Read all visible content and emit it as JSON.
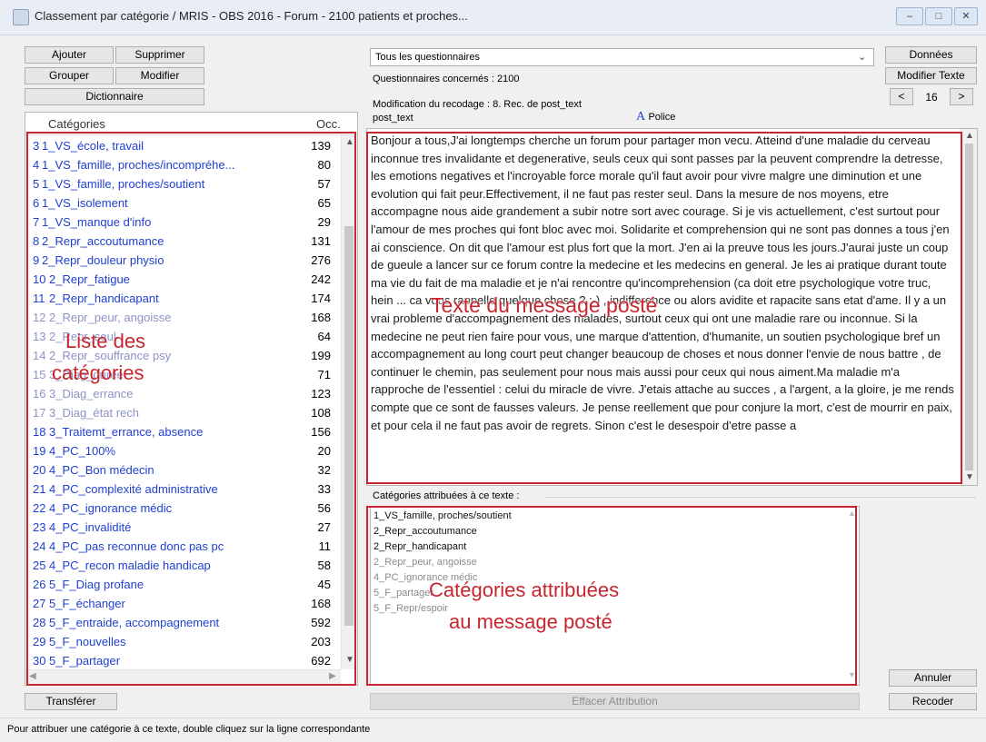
{
  "window": {
    "title": "Classement par catégorie / MRIS - OBS 2016 - Forum - 2100 patients et proches...",
    "minimize": "–",
    "maximize": "□",
    "close": "✕"
  },
  "left_buttons": {
    "add": "Ajouter",
    "delete": "Supprimer",
    "group": "Grouper",
    "modify": "Modifier",
    "dictionary": "Dictionnaire"
  },
  "categories": {
    "header_label": "Catégories",
    "header_count": "Occ.",
    "items": [
      {
        "num": "3",
        "label": "1_VS_école, travail",
        "occ": "139",
        "color": "#1f3fd1"
      },
      {
        "num": "4",
        "label": "1_VS_famille, proches/incompréhe...",
        "occ": "80",
        "color": "#1f3fd1"
      },
      {
        "num": "5",
        "label": "1_VS_famille, proches/soutient",
        "occ": "57",
        "color": "#1f3fd1"
      },
      {
        "num": "6",
        "label": "1_VS_isolement",
        "occ": "65",
        "color": "#1f3fd1"
      },
      {
        "num": "7",
        "label": "1_VS_manque d'info",
        "occ": "29",
        "color": "#1f3fd1"
      },
      {
        "num": "8",
        "label": "2_Repr_accoutumance",
        "occ": "131",
        "color": "#1f3fd1"
      },
      {
        "num": "9",
        "label": "2_Repr_douleur physio",
        "occ": "276",
        "color": "#1f3fd1"
      },
      {
        "num": "10",
        "label": "2_Repr_fatigue",
        "occ": "242",
        "color": "#1f3fd1"
      },
      {
        "num": "11",
        "label": "2_Repr_handicapant",
        "occ": "174",
        "color": "#1f3fd1"
      },
      {
        "num": "12",
        "label": "2_Repr_peur, angoisse",
        "occ": "168",
        "color": "#8c93c4"
      },
      {
        "num": "13",
        "label": "2_Repr_seul",
        "occ": "64",
        "color": "#8c93c4"
      },
      {
        "num": "14",
        "label": "2_Repr_souffrance psy",
        "occ": "199",
        "color": "#8c93c4"
      },
      {
        "num": "15",
        "label": "3_Diag_durée",
        "occ": "71",
        "color": "#8c93c4"
      },
      {
        "num": "16",
        "label": "3_Diag_errance",
        "occ": "123",
        "color": "#8c93c4"
      },
      {
        "num": "17",
        "label": "3_Diag_état rech",
        "occ": "108",
        "color": "#8c93c4"
      },
      {
        "num": "18",
        "label": "3_Traitemt_errance, absence",
        "occ": "156",
        "color": "#1f3fd1"
      },
      {
        "num": "19",
        "label": "4_PC_100%",
        "occ": "20",
        "color": "#1f3fd1"
      },
      {
        "num": "20",
        "label": "4_PC_Bon médecin",
        "occ": "32",
        "color": "#1f3fd1"
      },
      {
        "num": "21",
        "label": "4_PC_complexité administrative",
        "occ": "33",
        "color": "#1f3fd1"
      },
      {
        "num": "22",
        "label": "4_PC_ignorance médic",
        "occ": "56",
        "color": "#1f3fd1"
      },
      {
        "num": "23",
        "label": "4_PC_invalidité",
        "occ": "27",
        "color": "#1f3fd1"
      },
      {
        "num": "24",
        "label": "4_PC_pas reconnue donc pas pc",
        "occ": "11",
        "color": "#1f3fd1"
      },
      {
        "num": "25",
        "label": "4_PC_recon maladie handicap",
        "occ": "58",
        "color": "#1f3fd1"
      },
      {
        "num": "26",
        "label": "5_F_Diag profane",
        "occ": "45",
        "color": "#1f3fd1"
      },
      {
        "num": "27",
        "label": "5_F_échanger",
        "occ": "168",
        "color": "#1f3fd1"
      },
      {
        "num": "28",
        "label": "5_F_entraide, accompagnement",
        "occ": "592",
        "color": "#1f3fd1"
      },
      {
        "num": "29",
        "label": "5_F_nouvelles",
        "occ": "203",
        "color": "#1f3fd1"
      },
      {
        "num": "30",
        "label": "5_F_partager",
        "occ": "692",
        "color": "#1f3fd1"
      }
    ]
  },
  "overlay": {
    "list_label_line1": "Liste des",
    "list_label_line2": "catégories",
    "message_label": "Texte du message posté",
    "assigned_label_line1": "Catégories attribuées",
    "assigned_label_line2": "au message posté"
  },
  "transfer_button": "Transférer",
  "questionnaire": {
    "selected": "Tous les questionnaires",
    "concerned": "Questionnaires concernés : 2100",
    "recode_info": "Modification du recodage : 8. Rec. de post_text",
    "field_name": "post_text",
    "font_label": "Police",
    "font_icon": "A"
  },
  "right_buttons": {
    "data": "Données",
    "modify_text": "Modifier Texte",
    "prev": "<",
    "page": "16",
    "next": ">",
    "cancel": "Annuler",
    "recode": "Recoder"
  },
  "message_text": "Bonjour a tous,J'ai longtemps cherche un forum pour partager mon vecu. Atteind d'une maladie du cerveau inconnue tres invalidante et degenerative, seuls ceux qui sont passes par la peuvent comprendre la detresse, les emotions negatives et l'incroyable force morale qu'il faut avoir pour vivre malgre une diminution et une evolution qui fait peur.Effectivement, il ne faut pas rester seul. Dans la mesure de nos moyens, etre accompagne nous aide grandement a subir notre sort avec courage. Si je vis actuellement, c'est surtout pour l'amour de mes proches qui font bloc avec moi. Solidarite et comprehension qui ne sont pas donnes a tous j'en ai conscience. On dit que l'amour est plus fort que la mort. J'en ai la preuve tous les jours.J'aurai juste un coup de gueule a lancer sur ce forum contre la medecine et les medecins en general. Je les ai pratique durant toute ma vie du fait de ma maladie et je n'ai rencontre qu'incomprehension (ca doit etre psychologique votre truc, hein ... ca vous rappelle quelque chose ? ;-) , indifference ou alors avidite et rapacite sans etat d'ame. Il y a un vrai probleme d'accompagnement des malades, surtout ceux qui ont une maladie rare ou inconnue. Si la medecine ne peut rien faire pour vous, une marque d'attention, d'humanite, un soutien psychologique bref un accompagnement au long court peut changer beaucoup de choses et nous donner l'envie de nous battre , de continuer le chemin, pas seulement pour nous mais aussi pour ceux qui nous aiment.Ma maladie m'a rapproche de l'essentiel : celui du miracle de vivre. J'etais attache au succes , a l'argent, a la gloire, je me rends compte que ce sont de fausses valeurs. Je pense reellement que pour conjure la mort, c'est de mourrir en paix, et pour cela il ne faut pas avoir de regrets. Sinon c'est le desespoir d'etre passe a",
  "assigned": {
    "title": "Catégories attribuées à ce texte :",
    "items": [
      {
        "label": "1_VS_famille, proches/soutient",
        "color": "#111111"
      },
      {
        "label": "2_Repr_accoutumance",
        "color": "#111111"
      },
      {
        "label": "2_Repr_handicapant",
        "color": "#111111"
      },
      {
        "label": "2_Repr_peur, angoisse",
        "color": "#8a8a8a"
      },
      {
        "label": "4_PC_ignorance médic",
        "color": "#8a8a8a"
      },
      {
        "label": "5_F_partager",
        "color": "#8a8a8a"
      },
      {
        "label": "5_F_Repr/espoir",
        "color": "#8a8a8a"
      }
    ]
  },
  "clear_attribution": "Effacer Attribution",
  "status_bar": "Pour attribuer une catégorie à ce texte, double cliquez sur la ligne correspondante",
  "colors": {
    "highlight_red": "#c7262e",
    "category_blue": "#1f3fd1",
    "category_faded": "#8c93c4"
  }
}
